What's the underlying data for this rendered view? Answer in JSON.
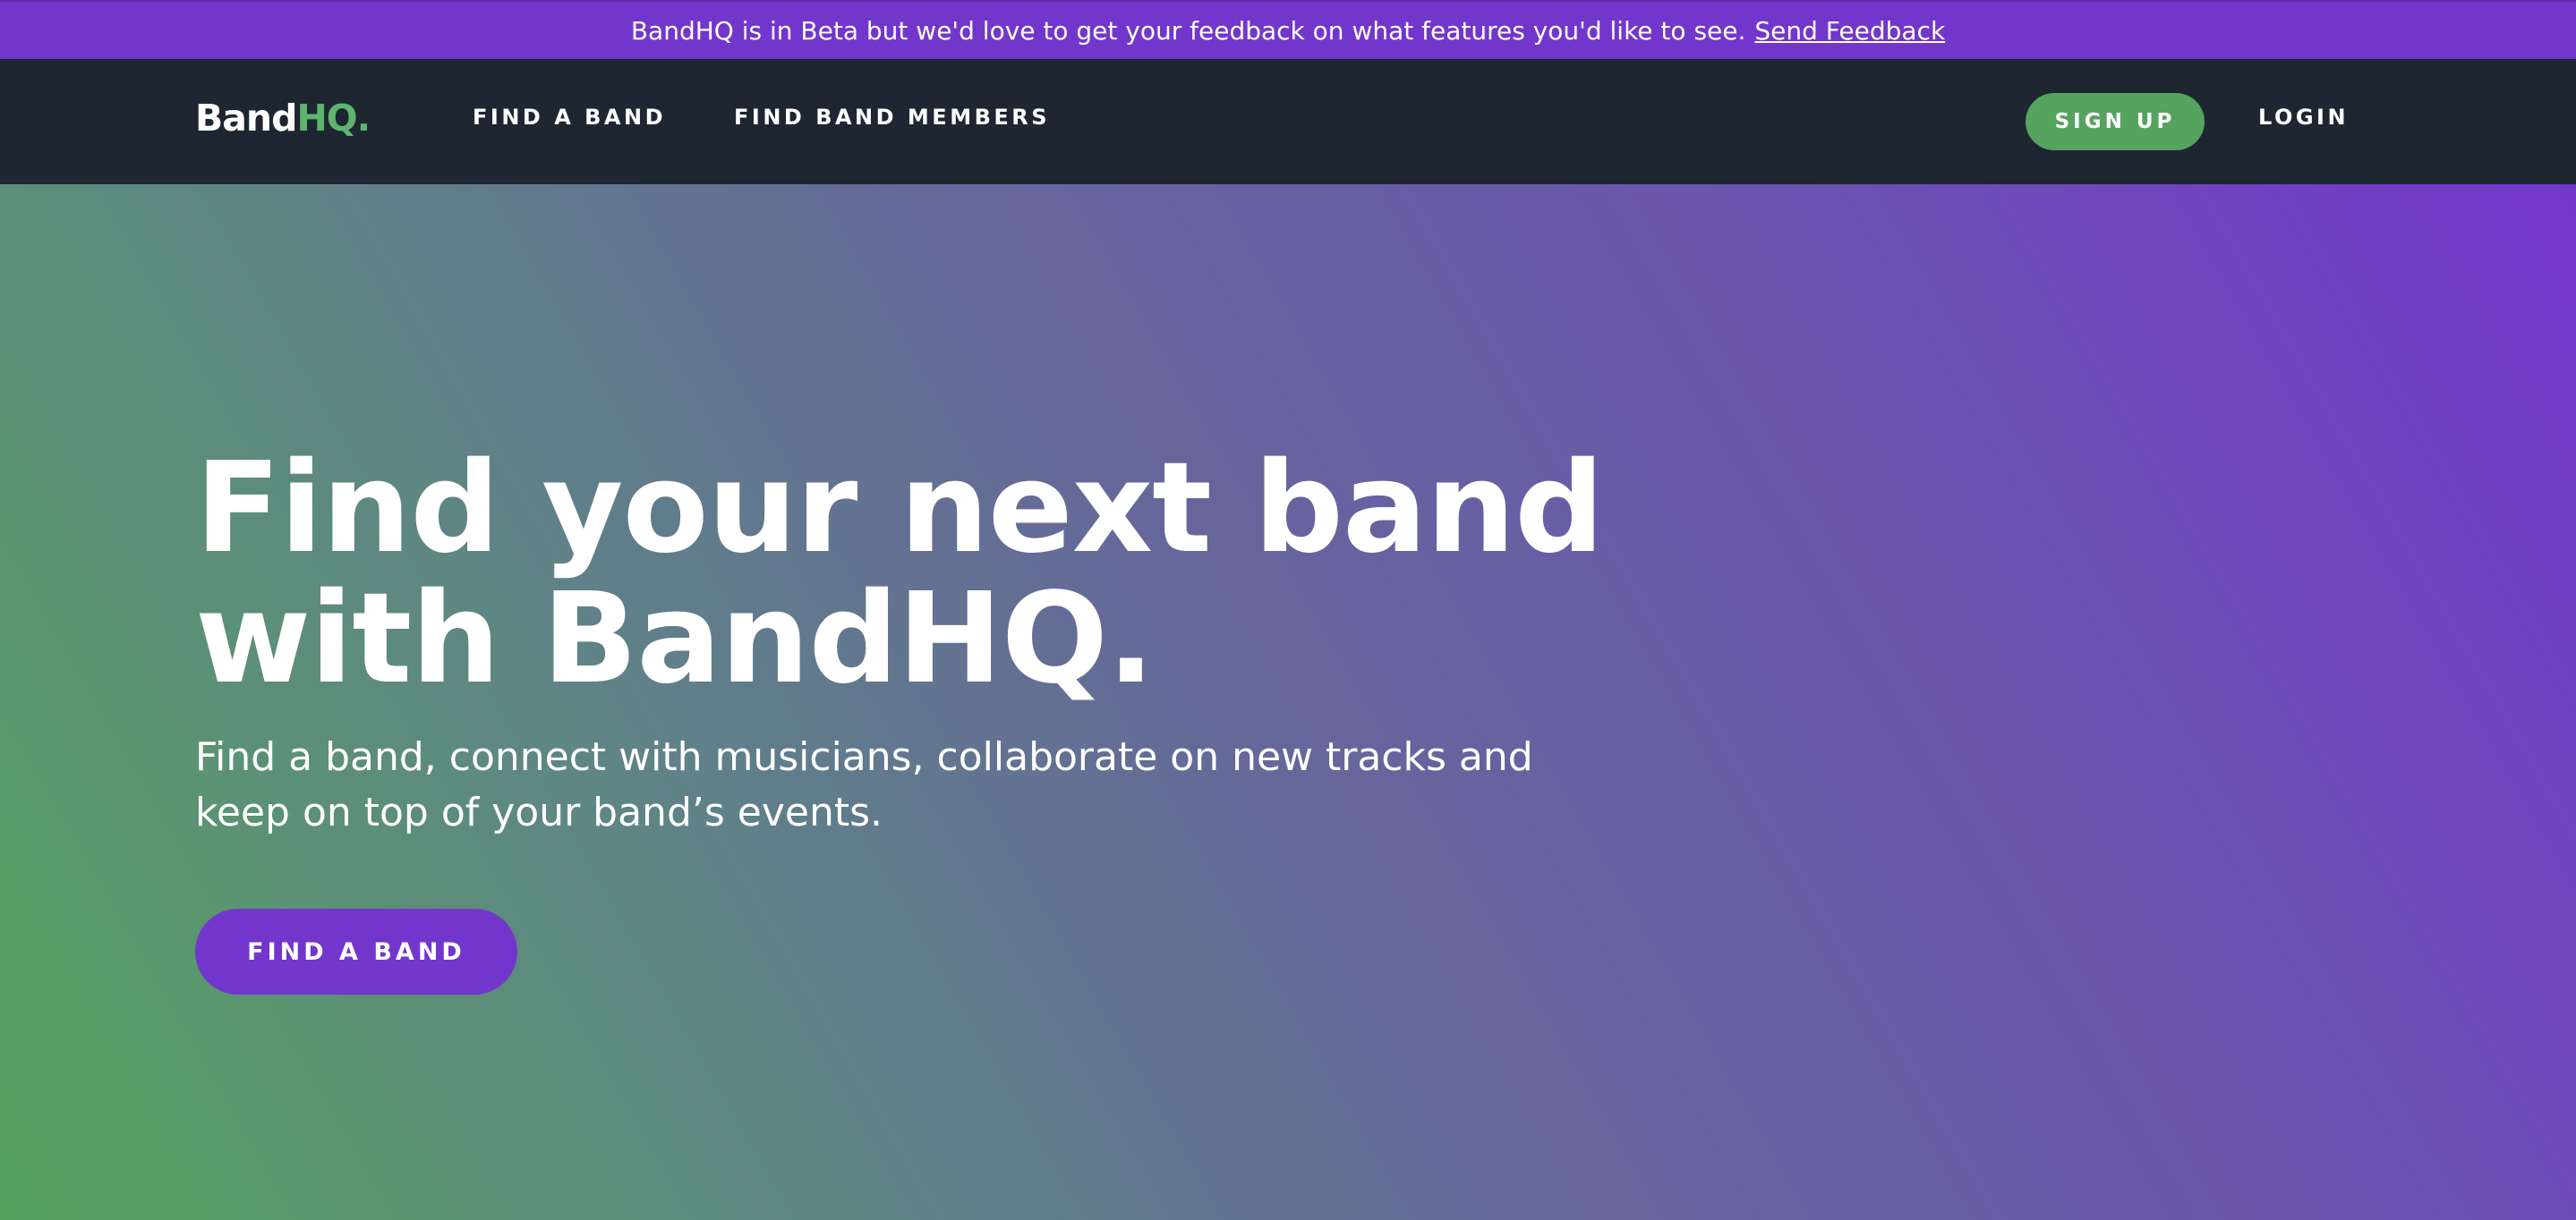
{
  "banner": {
    "message": "BandHQ is in Beta but we'd love to get your feedback on what features you'd like to see.",
    "feedback_link": "Send Feedback"
  },
  "nav": {
    "logo_band": "Band",
    "logo_hq": "HQ.",
    "links": [
      "FIND A BAND",
      "FIND BAND MEMBERS"
    ],
    "signup_label": "SIGN UP",
    "login_label": "LOGIN"
  },
  "hero": {
    "title_lines": [
      "Find your next band",
      "with BandHQ."
    ],
    "subtitle_lines": [
      "Find a band, connect with musicians, collaborate on new tracks and",
      "keep on top of your band’s events."
    ],
    "cta_label": "FIND A BAND"
  },
  "colors": {
    "purple": "#7236cc",
    "green": "#56a35f",
    "navbar": "#1e2631",
    "logo_accent": "#5eb56e"
  }
}
